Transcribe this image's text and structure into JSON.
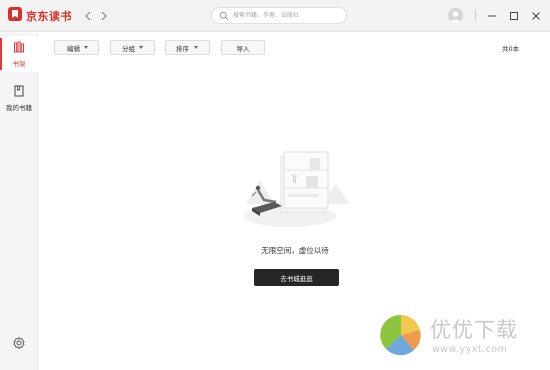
{
  "app": {
    "name": "京东读书"
  },
  "search": {
    "placeholder": "搜索书籍、作者、出版社"
  },
  "sidebar": {
    "items": [
      {
        "label": "书架",
        "icon": "bookshelf-icon",
        "active": true
      },
      {
        "label": "我的书籍",
        "icon": "book-icon",
        "active": false
      }
    ],
    "settings_icon": "settings-icon"
  },
  "toolbar": {
    "edit_label": "编辑",
    "group_label": "分组",
    "sort_label": "排序",
    "import_label": "导入",
    "count_label": "共0本"
  },
  "empty_state": {
    "message": "无限空间，虚位以待",
    "button_label": "去书城逛逛"
  },
  "watermark": {
    "title": "优优下载",
    "url": "www.yyxt.com"
  },
  "colors": {
    "accent": "#e4393c",
    "brand": "#d9302a",
    "button_dark": "#262626"
  }
}
